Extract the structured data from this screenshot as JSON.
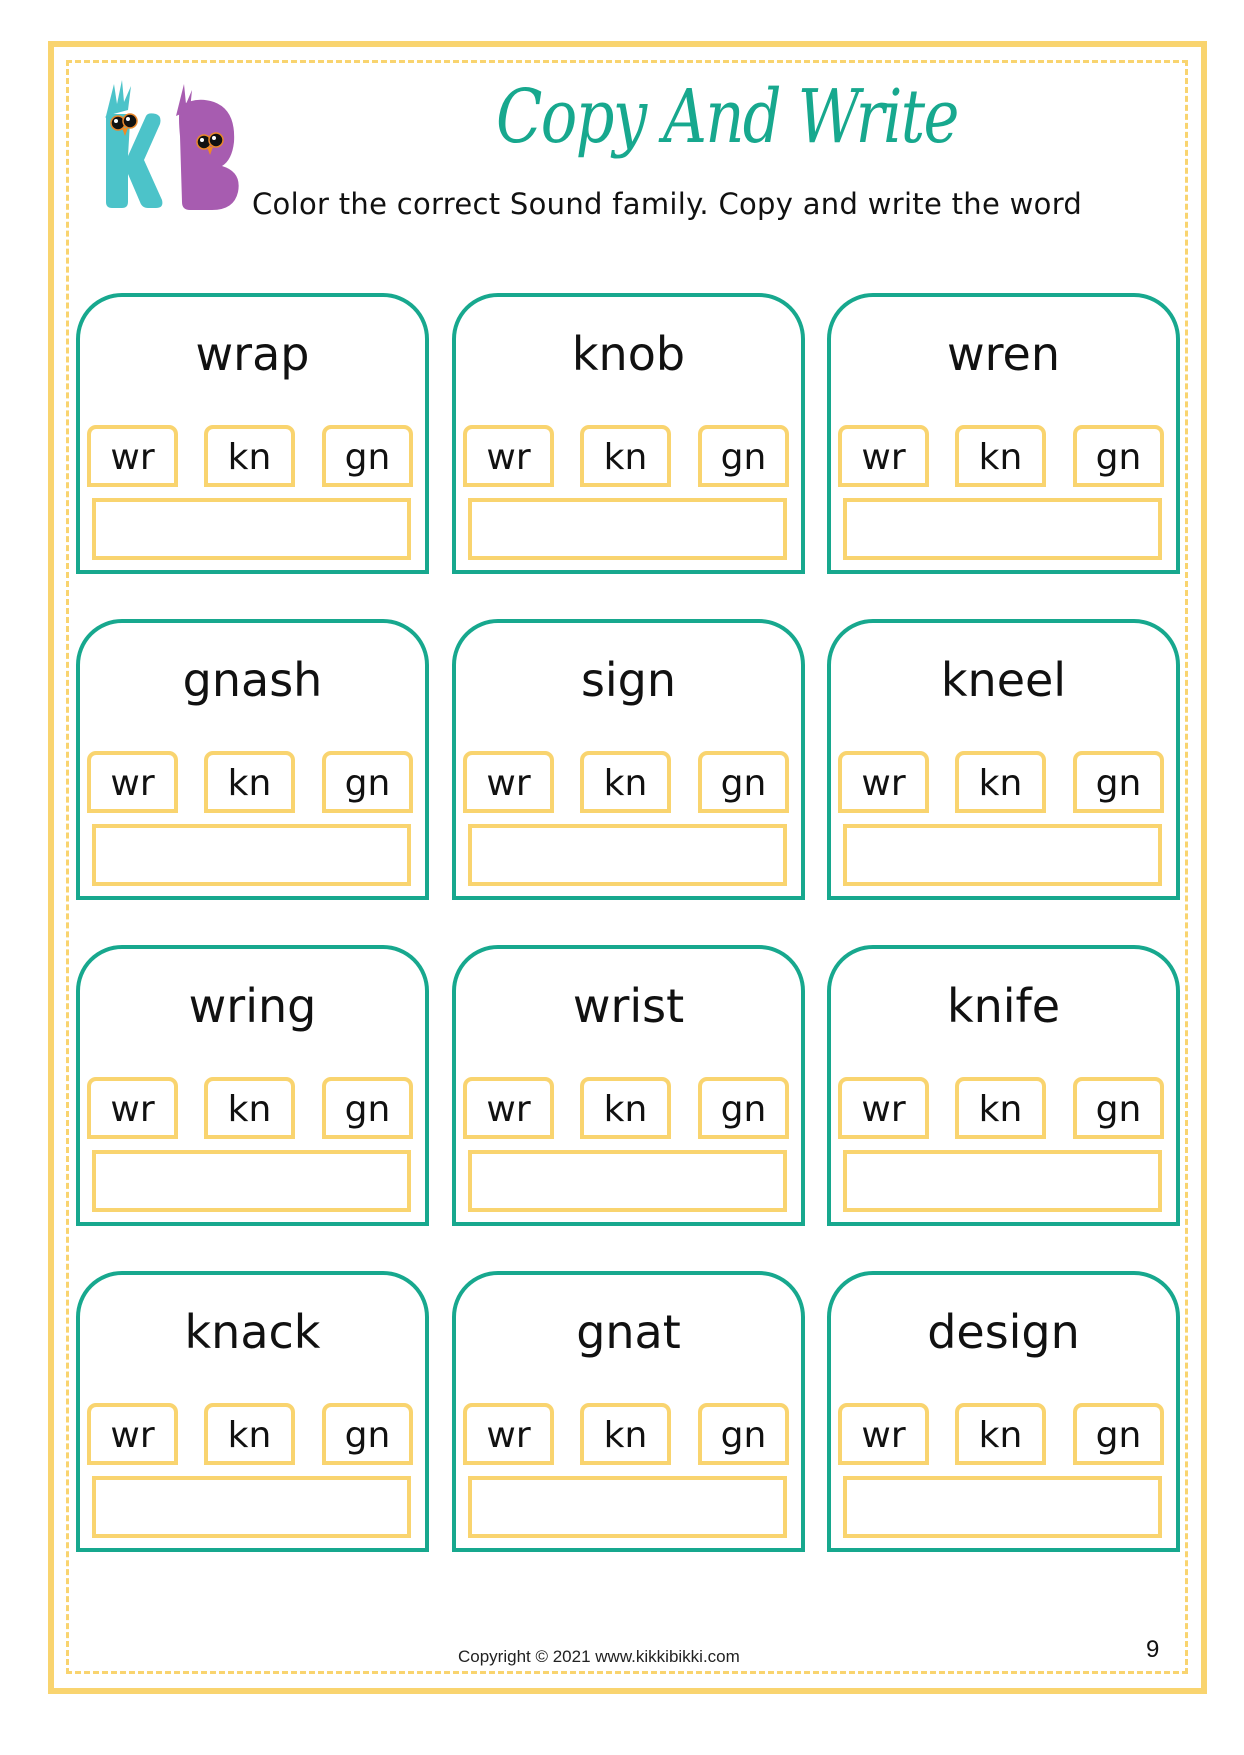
{
  "header": {
    "logo_label": "KB",
    "title": "Copy And Write",
    "subtitle": "Color the correct Sound family. Copy and write the word"
  },
  "colors": {
    "teal": "#17A88E",
    "yellow": "#F9D46F",
    "logo_k": "#4CC3C9",
    "logo_b": "#A75CB0"
  },
  "sound_options": [
    "wr",
    "kn",
    "gn"
  ],
  "cards": [
    {
      "word": "wrap",
      "options": [
        "wr",
        "kn",
        "gn"
      ],
      "answer": ""
    },
    {
      "word": "knob",
      "options": [
        "wr",
        "kn",
        "gn"
      ],
      "answer": ""
    },
    {
      "word": "wren",
      "options": [
        "wr",
        "kn",
        "gn"
      ],
      "answer": ""
    },
    {
      "word": "gnash",
      "options": [
        "wr",
        "kn",
        "gn"
      ],
      "answer": ""
    },
    {
      "word": "sign",
      "options": [
        "wr",
        "kn",
        "gn"
      ],
      "answer": ""
    },
    {
      "word": "kneel",
      "options": [
        "wr",
        "kn",
        "gn"
      ],
      "answer": ""
    },
    {
      "word": "wring",
      "options": [
        "wr",
        "kn",
        "gn"
      ],
      "answer": ""
    },
    {
      "word": "wrist",
      "options": [
        "wr",
        "kn",
        "gn"
      ],
      "answer": ""
    },
    {
      "word": "knife",
      "options": [
        "wr",
        "kn",
        "gn"
      ],
      "answer": ""
    },
    {
      "word": "knack",
      "options": [
        "wr",
        "kn",
        "gn"
      ],
      "answer": ""
    },
    {
      "word": "gnat",
      "options": [
        "wr",
        "kn",
        "gn"
      ],
      "answer": ""
    },
    {
      "word": "design",
      "options": [
        "wr",
        "kn",
        "gn"
      ],
      "answer": ""
    }
  ],
  "footer": {
    "copyright": "Copyright © 2021 www.kikkibikki.com",
    "page_number": "9"
  }
}
